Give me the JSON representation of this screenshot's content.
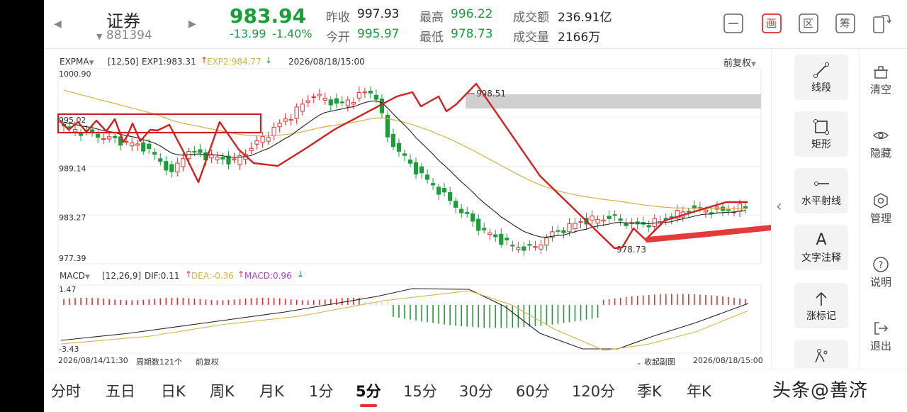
{
  "header": {
    "name": "证券",
    "code": "881394",
    "price": "983.94",
    "change": "-13.99",
    "change_pct": "-1.40%",
    "prev_close_label": "昨收",
    "prev_close": "997.93",
    "open_label": "今开",
    "open": "995.97",
    "high_label": "最高",
    "high": "996.22",
    "low_label": "最低",
    "low": "978.73",
    "amount_label": "成交额",
    "amount": "236.91亿",
    "volume_label": "成交量",
    "volume": "2166万"
  },
  "main_chart": {
    "indicator": "EXPMA",
    "params": "[12,50]",
    "exp1": "EXP1:983.31",
    "exp2": "EXP2:984.77",
    "datetime": "2026/08/18/15:00",
    "adjust": "前复权",
    "y_ticks": [
      "1000.90",
      "995.02",
      "989.14",
      "983.27",
      "977.39"
    ],
    "high_mark": "998.51",
    "low_mark": "978.73"
  },
  "sub_chart": {
    "indicator": "MACD",
    "params": "[12,26,9]",
    "dif": "DIF:0.11",
    "dea": "DEA:-0.36",
    "macd": "MACD:0.96",
    "y_top": "1.47",
    "y_bottom": "-3.43",
    "start_time": "2026/08/14/11:30",
    "period_count": "周期数121个",
    "adjust": "前复权",
    "collapse": "收起副图",
    "end_time": "2026/08/18/15:00"
  },
  "tools": [
    {
      "label": "线段"
    },
    {
      "label": "矩形"
    },
    {
      "label": "水平射线"
    },
    {
      "label": "文字注释"
    },
    {
      "label": "涨标记"
    }
  ],
  "right_tools": [
    {
      "label": "清空"
    },
    {
      "label": "隐藏"
    },
    {
      "label": "管理"
    },
    {
      "label": "说明"
    },
    {
      "label": "退出"
    }
  ],
  "header_buttons": {
    "draw": "画",
    "zone": "区",
    "chip": "筹"
  },
  "tabs": [
    "分时",
    "五日",
    "日K",
    "周K",
    "月K",
    "1分",
    "5分",
    "15分",
    "30分",
    "60分",
    "120分",
    "季K",
    "年K"
  ],
  "active_tab": "5分",
  "watermark": "头条@善济",
  "colors": {
    "up": "#e03232",
    "down": "#1a9e3a",
    "exp2": "#d4b24a"
  }
}
